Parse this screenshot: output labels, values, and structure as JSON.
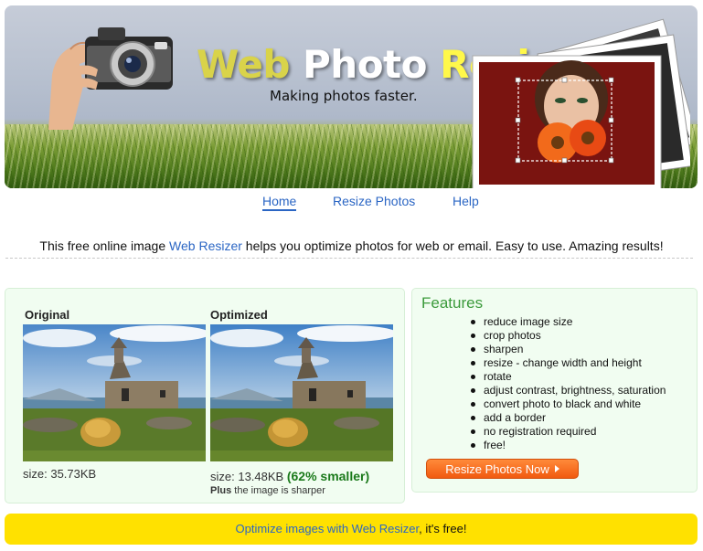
{
  "header": {
    "title_part1": "Web",
    "title_part2": "Photo",
    "title_part3": "Resizer",
    "tagline": "Making photos faster."
  },
  "nav": {
    "items": [
      {
        "label": "Home",
        "active": true
      },
      {
        "label": "Resize Photos",
        "active": false
      },
      {
        "label": "Help",
        "active": false
      }
    ]
  },
  "intro": {
    "before": "This free online image ",
    "link": "Web Resizer",
    "after": " helps you optimize photos for web or email. Easy to use. Amazing results!"
  },
  "compare": {
    "original_title": "Original",
    "optimized_title": "Optimized",
    "original_size": "size: 35.73KB",
    "optimized_size": "size: 13.48KB",
    "optimized_smaller": "(62% smaller)",
    "sharper_bold": "Plus",
    "sharper_rest": " the image is sharper"
  },
  "features": {
    "title": "Features",
    "items": [
      "reduce image size",
      "crop photos",
      "sharpen",
      "resize - change width and height",
      "rotate",
      "adjust contrast, brightness, saturation",
      "convert photo to black and white",
      "add a border",
      "no registration required",
      "free!"
    ],
    "cta_label": "Resize Photos Now"
  },
  "footer": {
    "link": "Optimize images with Web Resizer",
    "after": ", it's free!"
  },
  "colors": {
    "link": "#2b66c4",
    "panel_bg": "#f1fdf1",
    "feature_title": "#3b9a3b",
    "cta": "#f15a10",
    "footer_bg": "#ffe100",
    "smaller_green": "#1b7a1b"
  },
  "icons": {
    "cta_arrow": "right-triangle-icon"
  }
}
